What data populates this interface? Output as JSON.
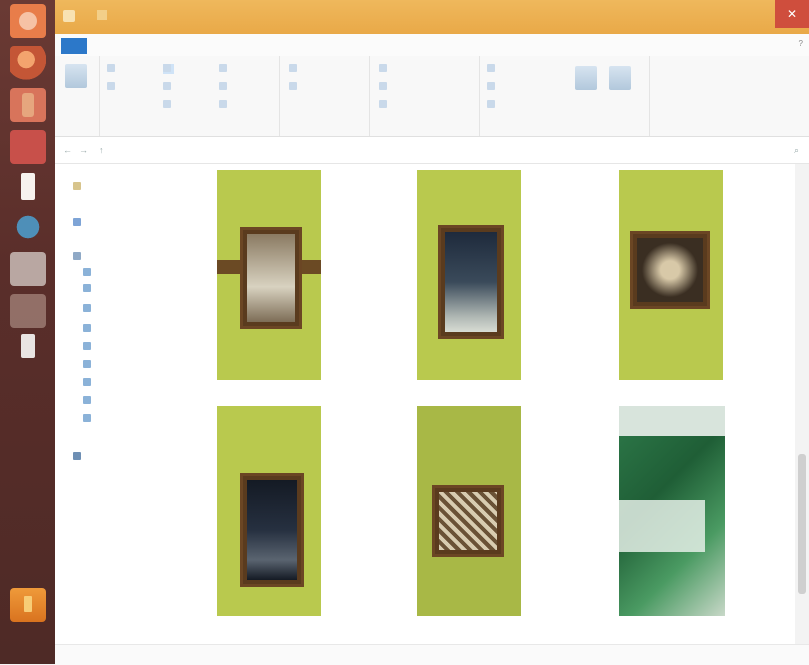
{
  "window": {
    "title": "",
    "close_glyph": "✕"
  },
  "menu": {
    "tabs": [
      "",
      "",
      "",
      ""
    ],
    "help": "?"
  },
  "ribbon": {
    "group_labels": [
      "",
      "",
      "",
      "",
      ""
    ],
    "items": [
      "",
      "",
      "",
      "",
      "",
      "",
      "",
      "",
      "",
      "",
      "",
      "",
      "",
      "",
      "",
      "",
      ""
    ]
  },
  "address": {
    "back": "←",
    "forward": "→",
    "up": "↑",
    "crumbs": [
      "",
      "",
      ""
    ],
    "search_placeholder": "",
    "search_icon": "search-icon"
  },
  "nav": {
    "items": [
      "",
      "",
      "",
      "",
      "",
      "",
      "",
      "",
      "",
      "",
      "",
      "",
      ""
    ]
  },
  "files": [
    {
      "name": ""
    },
    {
      "name": ""
    },
    {
      "name": ""
    },
    {
      "name": ""
    },
    {
      "name": ""
    },
    {
      "name": ""
    }
  ],
  "status": {
    "text": ""
  },
  "colors": {
    "accent": "#2c78c9",
    "titlebar": "#e9a948",
    "close": "#cf4e3d",
    "wall": "#b9c94e",
    "launcher": "#5a2e2a"
  }
}
